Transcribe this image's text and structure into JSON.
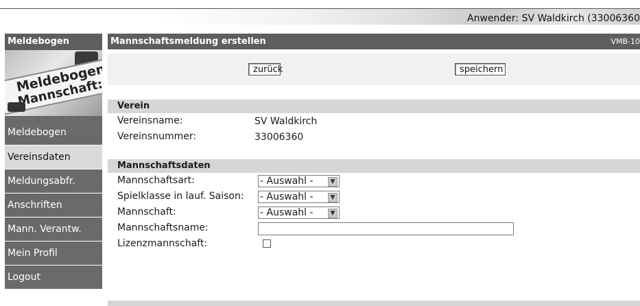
{
  "header": {
    "user": "Anwender: SV Waldkirch (33006360"
  },
  "sidebar": {
    "title": "Meldebogen",
    "logo_text": [
      "Meldebogen",
      "Mannschaft:"
    ],
    "items": [
      {
        "label": "Meldebogen",
        "active": false
      },
      {
        "label": "Vereinsdaten",
        "active": true
      },
      {
        "label": "Meldungsabfr.",
        "active": false
      },
      {
        "label": "Anschriften",
        "active": false
      },
      {
        "label": "Mann. Verantw.",
        "active": false
      },
      {
        "label": "Mein Profil",
        "active": false
      },
      {
        "label": "Logout",
        "active": false
      }
    ]
  },
  "main": {
    "title": "Mannschaftsmeldung erstellen",
    "code": "VMB-10",
    "buttons": {
      "back": "zurück",
      "save": "speichern"
    },
    "verein": {
      "heading": "Verein",
      "rows": [
        {
          "label": "Vereinsname:",
          "value": "SV Waldkirch"
        },
        {
          "label": "Vereinsnummer:",
          "value": "33006360"
        }
      ]
    },
    "mannschaft": {
      "heading": "Mannschaftsdaten",
      "art_label": "Mannschaftsart:",
      "art_value": "- Auswahl -",
      "spielklasse_label": "Spielklasse in lauf. Saison:",
      "spielklasse_value": "- Auswahl -",
      "mannschaft_label": "Mannschaft:",
      "mannschaft_value": "- Auswahl -",
      "name_label": "Mannschaftsname:",
      "name_value": "",
      "lizenz_label": "Lizenzmannschaft:"
    }
  },
  "icons": {
    "dropdown": "chevron-down-icon",
    "checkbox": "checkbox-unchecked"
  },
  "colors": {
    "sidebar_bg": "#6a6a6a",
    "sidebar_active": "#dadada",
    "titlebar": "#5e5e5e",
    "section_head": "#d6d6d6"
  }
}
